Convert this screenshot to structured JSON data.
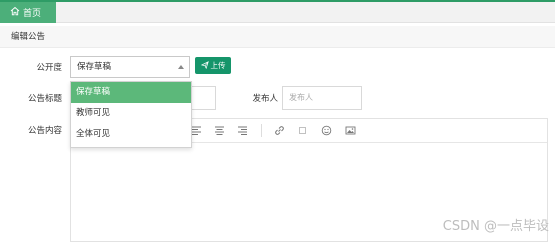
{
  "topbar": {
    "home_tab": "首页",
    "accent_color": "#2e9c66"
  },
  "section": {
    "title": "编辑公告"
  },
  "form": {
    "visibility_label": "公开度",
    "visibility_value": "保存草稿",
    "upload_label": "上传",
    "title_label": "公告标题",
    "title_value": "",
    "publisher_label": "发布人",
    "publisher_placeholder": "发布人",
    "content_label": "公告内容"
  },
  "dropdown": {
    "options": [
      {
        "label": "保存草稿",
        "selected": true
      },
      {
        "label": "教师可见",
        "selected": false
      },
      {
        "label": "全体可见",
        "selected": false
      }
    ],
    "selected_color": "#5cb87a"
  },
  "editor": {
    "toolbar_icons": [
      "align-left-icon",
      "align-center-icon",
      "align-right-icon",
      "link-icon",
      "unlink-icon",
      "emoji-icon",
      "image-icon"
    ]
  },
  "watermark": "CSDN @一点毕设"
}
